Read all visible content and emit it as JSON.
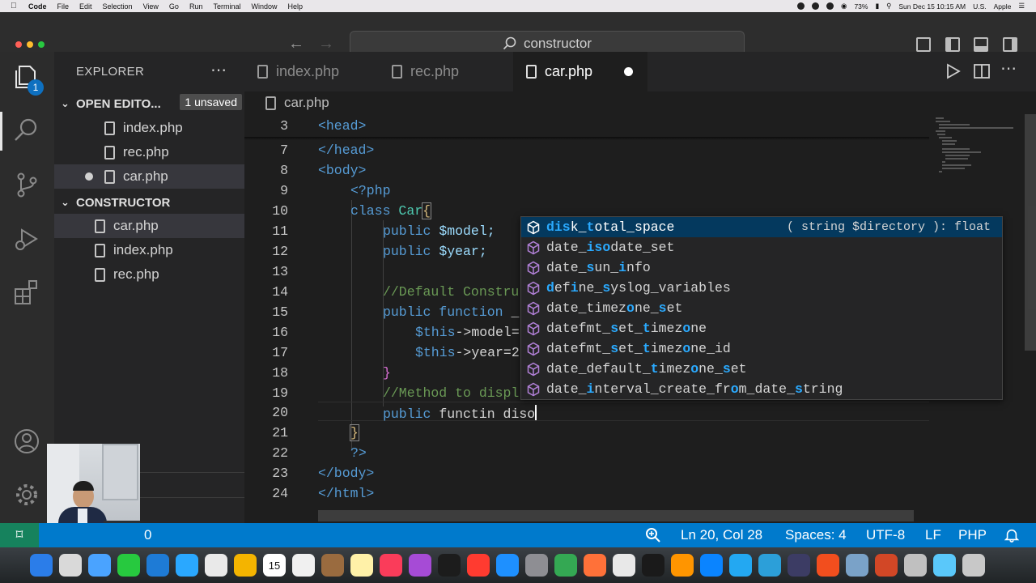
{
  "menubar": {
    "app_name": "Code",
    "items": [
      "File",
      "Edit",
      "Selection",
      "View",
      "Go",
      "Run",
      "Terminal",
      "Window",
      "Help"
    ],
    "battery": "73%",
    "datetime": "Sun Dec 15  10:15 AM",
    "locale": "U.S.",
    "user": "Apple"
  },
  "titlebar": {
    "search": "constructor"
  },
  "activity": {
    "explorer_badge": "1"
  },
  "sidebar": {
    "title": "EXPLORER",
    "open_editors": {
      "label": "OPEN EDITO...",
      "badge": "1 unsaved",
      "files": [
        "index.php",
        "rec.php",
        "car.php"
      ]
    },
    "folder": {
      "label": "CONSTRUCTOR",
      "files": [
        "car.php",
        "index.php",
        "rec.php"
      ]
    }
  },
  "tabs": [
    {
      "label": "index.php"
    },
    {
      "label": "rec.php"
    },
    {
      "label": "car.php"
    }
  ],
  "breadcrumb": "car.php",
  "editor": {
    "lines": [
      {
        "n": "3"
      },
      {
        "n": "7"
      },
      {
        "n": "8"
      },
      {
        "n": "9"
      },
      {
        "n": "10"
      },
      {
        "n": "11"
      },
      {
        "n": "12"
      },
      {
        "n": "13"
      },
      {
        "n": "14"
      },
      {
        "n": "15"
      },
      {
        "n": "16"
      },
      {
        "n": "17"
      },
      {
        "n": "18"
      },
      {
        "n": "19"
      },
      {
        "n": "20"
      },
      {
        "n": "21"
      },
      {
        "n": "22"
      },
      {
        "n": "23"
      },
      {
        "n": "24"
      }
    ],
    "code": {
      "l3": "<head>",
      "l7": "</head>",
      "l8": "<body>",
      "l9": "<?php",
      "l10_kw": "class",
      "l10_cls": "Car",
      "l10_brace": "{",
      "l11_kw": "public",
      "l11_var": "$model;",
      "l12_kw": "public",
      "l12_var": "$year;",
      "l14": "//Default Constru",
      "l15_kw": "public function",
      "l15_rest": "_",
      "l16_var": "$this",
      "l16_rest": "->model=",
      "l17_var": "$this",
      "l17_rest": "->year=2",
      "l18": "}",
      "l19": "//Method to displ",
      "l20_kw": "public",
      "l20_rest": "functin diso",
      "l21": "}",
      "l22": "?>",
      "l23": "</body>",
      "l24": "</html>"
    }
  },
  "suggest": {
    "items": [
      {
        "parts": [
          [
            "dis",
            "h"
          ],
          [
            "k_",
            "n"
          ],
          [
            "t",
            "h"
          ],
          [
            "otal_space",
            "n"
          ]
        ],
        "detail": "( string $directory ): float"
      },
      {
        "parts": [
          [
            "d",
            "n"
          ],
          [
            "a",
            "n"
          ],
          [
            "te_",
            "n"
          ],
          [
            "iso",
            "h"
          ],
          [
            "date_set",
            "n"
          ]
        ]
      },
      {
        "parts": [
          [
            "date_",
            "n"
          ],
          [
            "s",
            "h"
          ],
          [
            "un_",
            "n"
          ],
          [
            "i",
            "h"
          ],
          [
            "nfo",
            "n"
          ]
        ]
      },
      {
        "parts": [
          [
            "d",
            "h"
          ],
          [
            "ef",
            "n"
          ],
          [
            "i",
            "h"
          ],
          [
            "ne_",
            "n"
          ],
          [
            "s",
            "h"
          ],
          [
            "yslo",
            "n"
          ],
          [
            "g_variables",
            "n"
          ]
        ]
      },
      {
        "parts": [
          [
            "date_",
            "n"
          ],
          [
            "t",
            "n"
          ],
          [
            "imez",
            "n"
          ],
          [
            "o",
            "h"
          ],
          [
            "ne_",
            "n"
          ],
          [
            "s",
            "h"
          ],
          [
            "et",
            "n"
          ]
        ]
      },
      {
        "parts": [
          [
            "datefmt_",
            "n"
          ],
          [
            "s",
            "h"
          ],
          [
            "et_",
            "n"
          ],
          [
            "t",
            "h"
          ],
          [
            "imez",
            "n"
          ],
          [
            "o",
            "h"
          ],
          [
            "ne",
            "n"
          ]
        ]
      },
      {
        "parts": [
          [
            "datefmt_",
            "n"
          ],
          [
            "s",
            "h"
          ],
          [
            "et_",
            "n"
          ],
          [
            "t",
            "h"
          ],
          [
            "imez",
            "n"
          ],
          [
            "o",
            "h"
          ],
          [
            "ne_id",
            "n"
          ]
        ]
      },
      {
        "parts": [
          [
            "date_default_",
            "n"
          ],
          [
            "t",
            "h"
          ],
          [
            "imez",
            "n"
          ],
          [
            "o",
            "h"
          ],
          [
            "ne_",
            "n"
          ],
          [
            "s",
            "h"
          ],
          [
            "et",
            "n"
          ]
        ]
      },
      {
        "parts": [
          [
            "date_",
            "n"
          ],
          [
            "i",
            "h"
          ],
          [
            "nterval_create_fr",
            "n"
          ],
          [
            "o",
            "h"
          ],
          [
            "m_date_",
            "n"
          ],
          [
            "s",
            "h"
          ],
          [
            "tring",
            "n"
          ]
        ]
      }
    ]
  },
  "statusbar": {
    "problems": "0",
    "position": "Ln 20, Col 28",
    "spaces": "Spaces: 4",
    "encoding": "UTF-8",
    "eol": "LF",
    "language": "PHP"
  },
  "dock": {
    "calendar_day": "15",
    "colors": [
      "#2b7de9",
      "#d9d9d9",
      "#4aa3ff",
      "#27c93f",
      "#1e7bd6",
      "#2aa8ff",
      "#e9e9e9",
      "#f4b400",
      "#ffffff",
      "#f0f0f0",
      "#9a6b3f",
      "#fff1a8",
      "#fa3c5a",
      "#a64bd6",
      "#1c1c1c",
      "#ff3b30",
      "#1e90ff",
      "#8e8e93",
      "#34a853",
      "#ff7139",
      "#e8e8e8",
      "#1a1a1a",
      "#ff9500",
      "#0a84ff",
      "#23a8f2",
      "#2c9fd9",
      "#3c3c64",
      "#f24e1e",
      "#7aa2c8",
      "#d24726",
      "#c0c0c0",
      "#5ac8fa",
      "#c8c8c8"
    ]
  }
}
